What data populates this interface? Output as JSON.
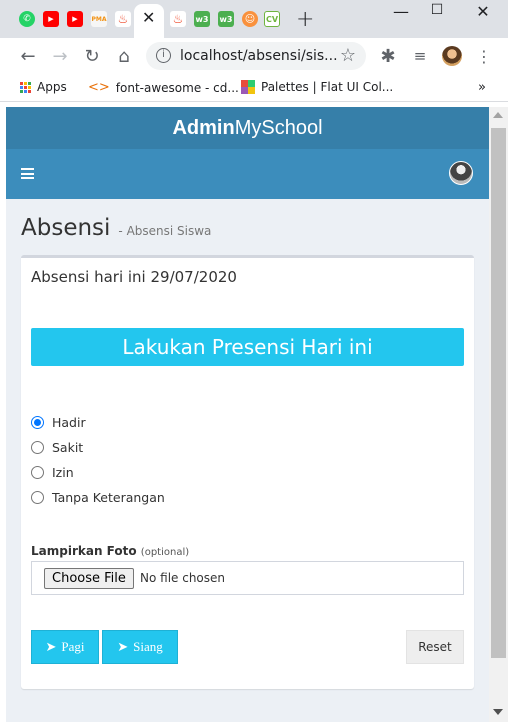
{
  "browser": {
    "favicons": [
      {
        "name": "whatsapp-icon",
        "color": "#25d366",
        "glyph": "✆"
      },
      {
        "name": "youtube-icon",
        "color": "#ff0000",
        "glyph": "▶"
      },
      {
        "name": "youtube-icon",
        "color": "#ff0000",
        "glyph": "▶"
      },
      {
        "name": "phpmyadmin-icon",
        "color": "#f29111",
        "glyph": "PMA"
      },
      {
        "name": "codeigniter-icon",
        "color": "#ee4323",
        "glyph": "🔥"
      },
      {
        "name": "codeigniter-icon",
        "color": "#ee4323",
        "glyph": "🔥"
      },
      {
        "name": "w3schools-icon",
        "color": "#4caf50",
        "glyph": "w3"
      },
      {
        "name": "w3schools-icon",
        "color": "#4caf50",
        "glyph": "w3"
      },
      {
        "name": "colorhunt-icon",
        "color": "#f9913d",
        "glyph": "☺"
      },
      {
        "name": "cv-icon",
        "color": "#6fb43f",
        "glyph": "CV"
      }
    ],
    "url": "localhost/absensi/sis...",
    "bookmarks": {
      "apps": "Apps",
      "fontawesome": "font-awesome - cd...",
      "palettes": "Palettes | Flat UI Col..."
    }
  },
  "app": {
    "logo_bold": "Admin",
    "logo_light": "MySchool"
  },
  "content": {
    "title": "Absensi",
    "subtitle": "- Absensi Siswa",
    "date_text": "Absensi hari ini 29/07/2020",
    "presensi_label": "Lakukan Presensi Hari ini",
    "options": [
      {
        "label": "Hadir",
        "checked": true
      },
      {
        "label": "Sakit",
        "checked": false
      },
      {
        "label": "Izin",
        "checked": false
      },
      {
        "label": "Tanpa Keterangan",
        "checked": false
      }
    ],
    "attachment_label": "Lampirkan Foto",
    "attachment_optional": "(optional)",
    "choose_file": "Choose File",
    "no_file": "No file chosen",
    "pagi_label": "Pagi",
    "siang_label": "Siang",
    "reset_label": "Reset"
  },
  "colors": {
    "header_dark": "#367fa9",
    "header": "#3c8dbc",
    "accent": "#23c6ee",
    "background": "#ecf0f5"
  }
}
